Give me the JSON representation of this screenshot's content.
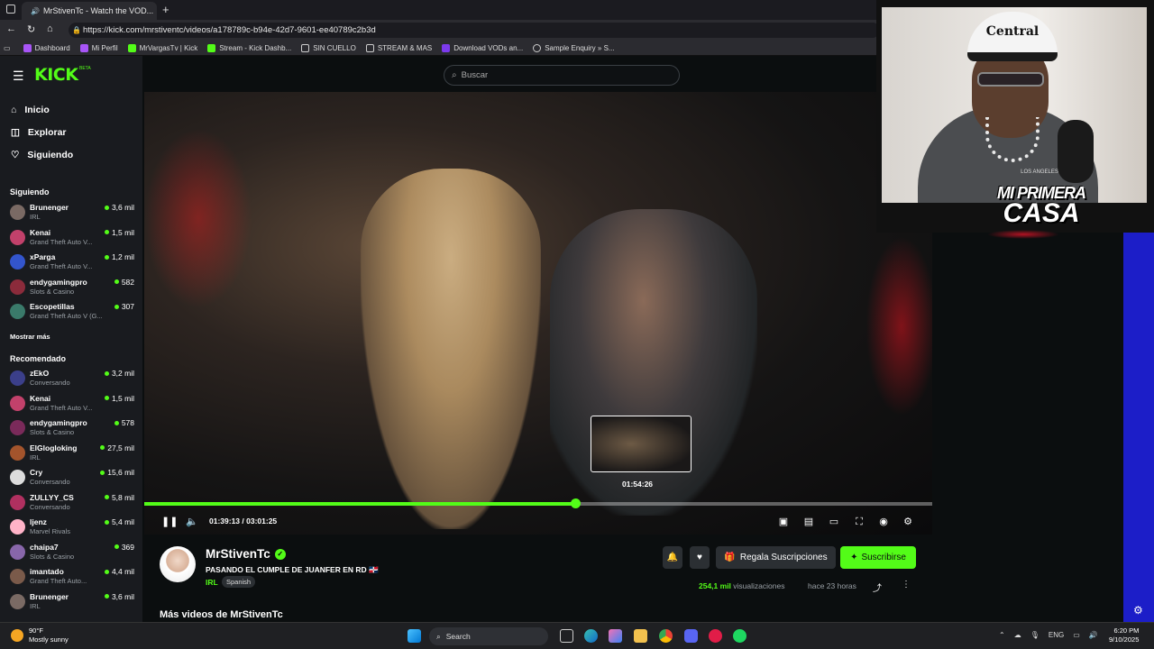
{
  "browser": {
    "tab_title": "MrStivenTc - Watch the VOD...",
    "url": "https://kick.com/mrstiventc/videos/a178789c-b94e-42d7-9601-ee40789c2b3d",
    "bookmarks": [
      "Dashboard",
      "Mi Perfil",
      "MrVargasTv | Kick",
      "Stream - Kick Dashb...",
      "SIN CUELLO",
      "STREAM & MAS",
      "Download VODs an...",
      "Sample Enquiry » S..."
    ]
  },
  "header": {
    "logo": "KICK",
    "logo_badge": "BETA",
    "search_placeholder": "Buscar"
  },
  "nav": {
    "home": "Inicio",
    "explore": "Explorar",
    "following": "Siguiendo"
  },
  "following": {
    "title": "Siguiendo",
    "channels": [
      {
        "name": "Brunenger",
        "category": "IRL",
        "viewers": "3,6 mil"
      },
      {
        "name": "Kenai",
        "category": "Grand Theft Auto V...",
        "viewers": "1,5 mil"
      },
      {
        "name": "xParga",
        "category": "Grand Theft Auto V...",
        "viewers": "1,2 mil"
      },
      {
        "name": "endygamingpro",
        "category": "Slots & Casino",
        "viewers": "582"
      },
      {
        "name": "Escopetillas",
        "category": "Grand Theft Auto V (G...",
        "viewers": "307"
      }
    ],
    "show_more": "Mostrar más"
  },
  "recommended": {
    "title": "Recomendado",
    "channels": [
      {
        "name": "zEkO",
        "category": "Conversando",
        "viewers": "3,2 mil"
      },
      {
        "name": "Kenai",
        "category": "Grand Theft Auto V...",
        "viewers": "1,5 mil"
      },
      {
        "name": "endygamingpro",
        "category": "Slots & Casino",
        "viewers": "578"
      },
      {
        "name": "ElGlogloking",
        "category": "IRL",
        "viewers": "27,5 mil"
      },
      {
        "name": "Cry",
        "category": "Conversando",
        "viewers": "15,6 mil"
      },
      {
        "name": "ZULLYY_CS",
        "category": "Conversando",
        "viewers": "5,8 mil"
      },
      {
        "name": "ljenz",
        "category": "Marvel Rivals",
        "viewers": "5,4 mil"
      },
      {
        "name": "chaipa7",
        "category": "Slots & Casino",
        "viewers": "369"
      },
      {
        "name": "imantado",
        "category": "Grand Theft Auto...",
        "viewers": "4,4 mil"
      },
      {
        "name": "Brunenger",
        "category": "IRL",
        "viewers": "3,6 mil"
      }
    ]
  },
  "player": {
    "current_time": "01:39:13",
    "duration": "03:01:25",
    "hover_time": "01:54:26",
    "progress": 0.548
  },
  "webcam": {
    "hat_text": "Central",
    "shirt_text": "LOS ANGELES",
    "caption_line1": "MI PRIMERA",
    "caption_line2": "CASA"
  },
  "channel": {
    "name": "MrStivenTc",
    "title": "PASANDO EL CUMPLE DE JUANFER EN RD 🇩🇴",
    "category": "IRL",
    "language": "Spanish",
    "gift_label": "Regala Suscripciones",
    "subscribe_label": "Suscribirse",
    "views": "254,1 mil",
    "views_label": "visualizaciones",
    "ago": "hace 23 horas"
  },
  "more_videos": "Más videos de MrStivenTc",
  "taskbar": {
    "temp": "90°F",
    "weather": "Mostly sunny",
    "search": "Search",
    "lang": "ENG",
    "time": "6:20 PM",
    "date": "9/10/2025"
  },
  "colors": {
    "accent": "#53fc18",
    "bg": "#0b0e0f",
    "sidebar": "#191b1f"
  }
}
